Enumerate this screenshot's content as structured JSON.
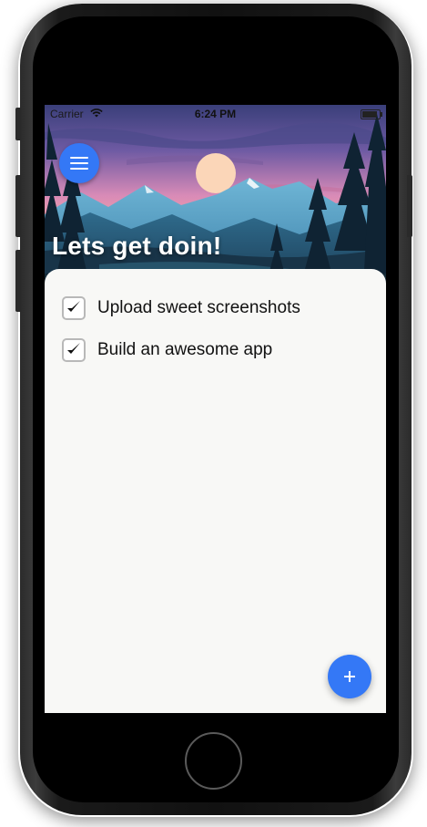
{
  "status_bar": {
    "carrier": "Carrier",
    "time": "6:24 PM",
    "icons": [
      "wifi-icon",
      "battery-icon"
    ]
  },
  "header": {
    "title": "Lets get doin!",
    "menu_icon": "hamburger-menu-icon"
  },
  "todos": [
    {
      "text": "Upload sweet screenshots",
      "checked": true
    },
    {
      "text": "Build an awesome app",
      "checked": true
    }
  ],
  "fab": {
    "label": "+",
    "icon": "plus-icon"
  },
  "colors": {
    "accent": "#3478f6",
    "sheet_background": "#f8f8f6",
    "text": "#111111"
  }
}
